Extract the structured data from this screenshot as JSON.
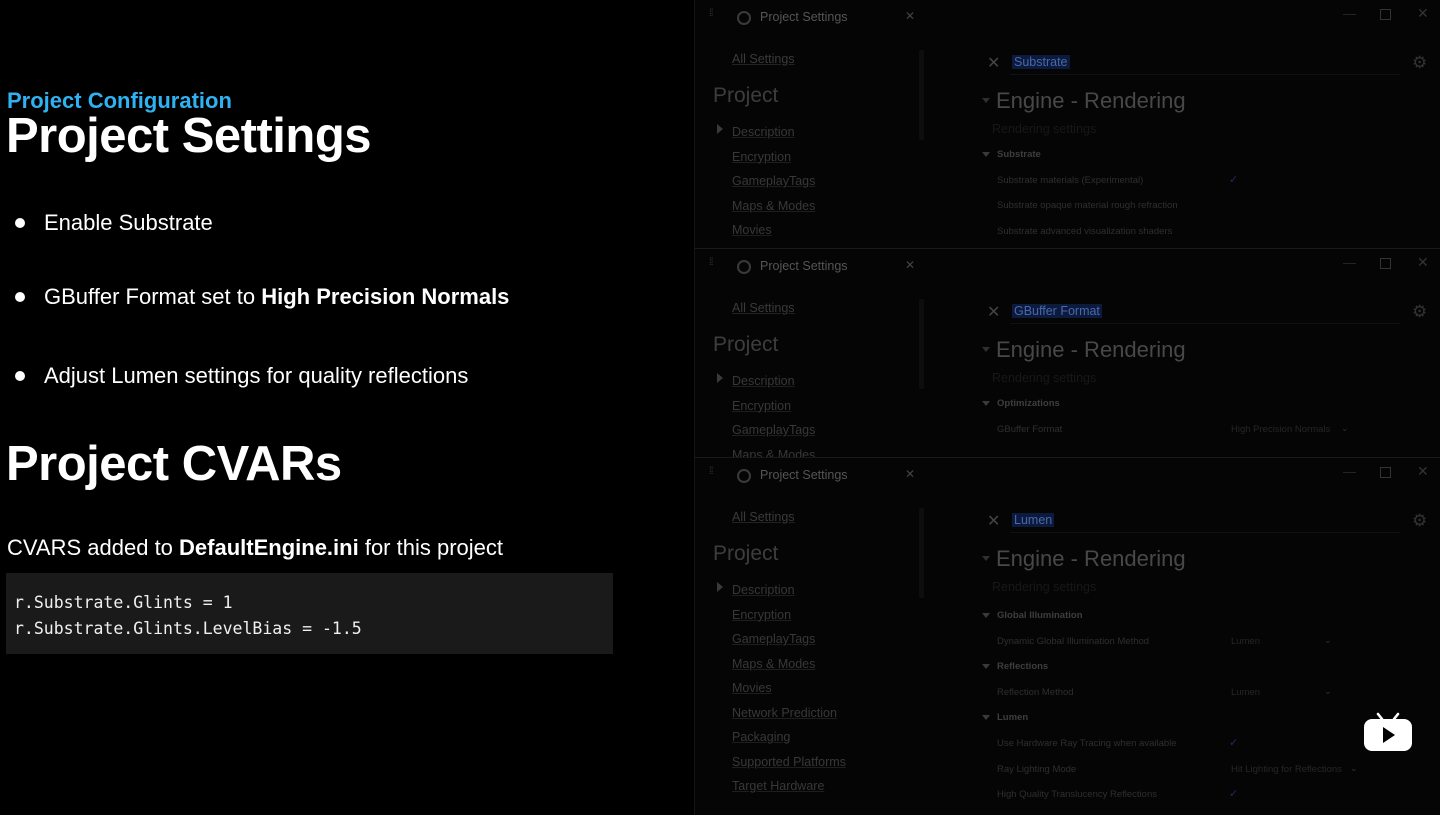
{
  "slide": {
    "kicker": "Project Configuration",
    "title": "Project Settings",
    "bullets": [
      {
        "plain": "Enable Substrate",
        "bold": ""
      },
      {
        "plain": "GBuffer Format set to ",
        "bold": "High Precision Normals"
      },
      {
        "plain": "Adjust Lumen settings for quality reflections",
        "bold": ""
      }
    ],
    "cvars_title": "Project CVARs",
    "cvars_desc": {
      "pre": "CVARS added to ",
      "bold": "DefaultEngine.ini",
      "post": " for this project"
    },
    "code": [
      "r.Substrate.Glints = 1",
      "r.Substrate.Glints.LevelBias = -1.5"
    ]
  },
  "panels": [
    {
      "tab_title": "Project Settings",
      "all_settings": "All Settings",
      "project_heading": "Project",
      "nav": [
        "Description",
        "Encryption",
        "GameplayTags",
        "Maps & Modes",
        "Movies"
      ],
      "search": "Substrate",
      "category": "Engine - Rendering",
      "subtitle": "Rendering settings",
      "sections": [
        {
          "label": "Substrate",
          "rows": [
            {
              "label": "Substrate materials (Experimental)",
              "checked": true
            },
            {
              "label": "Substrate opaque material rough refraction"
            },
            {
              "label": "Substrate advanced visualization shaders"
            }
          ]
        }
      ]
    },
    {
      "tab_title": "Project Settings",
      "all_settings": "All Settings",
      "project_heading": "Project",
      "nav": [
        "Description",
        "Encryption",
        "GameplayTags",
        "Maps & Modes"
      ],
      "search": "GBuffer Format",
      "category": "Engine - Rendering",
      "subtitle": "Rendering settings",
      "sections": [
        {
          "label": "Optimizations",
          "rows": [
            {
              "label": "GBuffer Format",
              "value": "High Precision Normals"
            }
          ]
        }
      ]
    },
    {
      "tab_title": "Project Settings",
      "all_settings": "All Settings",
      "project_heading": "Project",
      "nav": [
        "Description",
        "Encryption",
        "GameplayTags",
        "Maps & Modes",
        "Movies",
        "Network Prediction",
        "Packaging",
        "Supported Platforms",
        "Target Hardware"
      ],
      "search": "Lumen",
      "category": "Engine - Rendering",
      "subtitle": "Rendering settings",
      "sections": [
        {
          "label": "Global Illumination",
          "rows": [
            {
              "label": "Dynamic Global Illumination Method",
              "value": "Lumen"
            }
          ]
        },
        {
          "label": "Reflections",
          "rows": [
            {
              "label": "Reflection Method",
              "value": "Lumen"
            }
          ]
        },
        {
          "label": "Lumen",
          "rows": [
            {
              "label": "Use Hardware Ray Tracing when available",
              "checked": true
            },
            {
              "label": "Ray Lighting Mode",
              "value": "Hit Lighting for Reflections"
            },
            {
              "label": "High Quality Translucency Reflections",
              "checked": true
            }
          ]
        }
      ]
    }
  ],
  "icons": {
    "tab": "settings-icon",
    "clear": "close-icon",
    "gear": "gear-icon",
    "watermark": "bilibili-icon"
  }
}
